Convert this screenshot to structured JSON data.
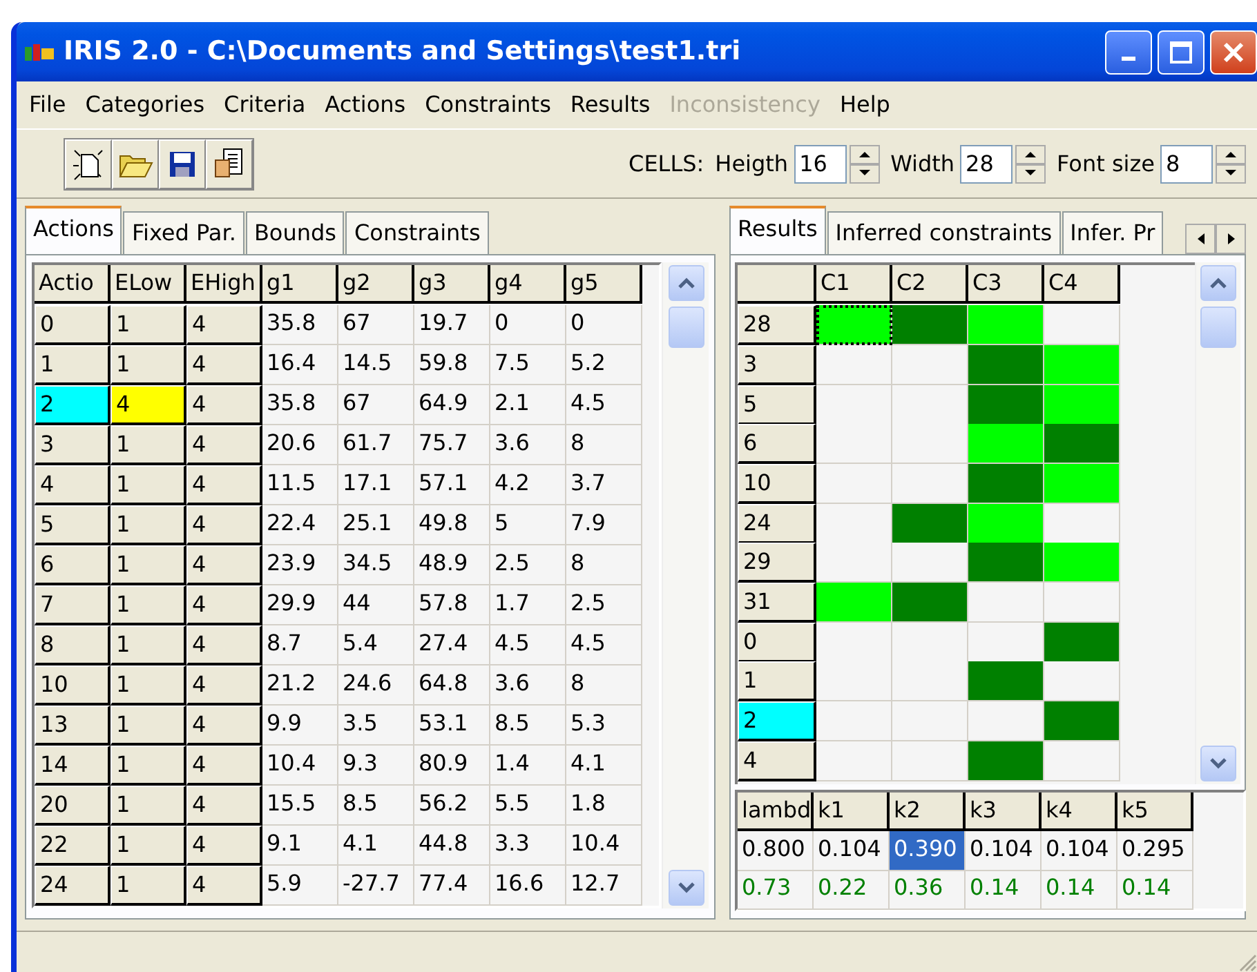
{
  "window": {
    "title": "IRIS 2.0  -  C:\\Documents and Settings\\test1.tri"
  },
  "menu": [
    {
      "label": "File",
      "disabled": false
    },
    {
      "label": "Categories",
      "disabled": false
    },
    {
      "label": "Criteria",
      "disabled": false
    },
    {
      "label": "Actions",
      "disabled": false
    },
    {
      "label": "Constraints",
      "disabled": false
    },
    {
      "label": "Results",
      "disabled": false
    },
    {
      "label": "Inconsistency",
      "disabled": true
    },
    {
      "label": "Help",
      "disabled": false
    }
  ],
  "toolbar": {
    "cells_label": "CELLS:",
    "spinners": [
      {
        "label": "Heigth",
        "value": "16"
      },
      {
        "label": "Width",
        "value": "28"
      },
      {
        "label": "Font size",
        "value": "8"
      }
    ]
  },
  "left_tabs": [
    {
      "label": "Actions",
      "selected": true
    },
    {
      "label": "Fixed Par.",
      "selected": false
    },
    {
      "label": "Bounds",
      "selected": false
    },
    {
      "label": "Constraints",
      "selected": false
    }
  ],
  "actions_table": {
    "columns": [
      "Actio",
      "ELow",
      "EHigh",
      "g1",
      "g2",
      "g3",
      "g4",
      "g5"
    ],
    "rows": [
      {
        "action": "0",
        "selected": false,
        "elow": "1",
        "modified": false,
        "ehigh": "4",
        "values": [
          "35.8",
          "67",
          "19.7",
          "0",
          "0"
        ]
      },
      {
        "action": "1",
        "selected": false,
        "elow": "1",
        "modified": false,
        "ehigh": "4",
        "values": [
          "16.4",
          "14.5",
          "59.8",
          "7.5",
          "5.2"
        ]
      },
      {
        "action": "2",
        "selected": true,
        "elow": "4",
        "modified": true,
        "ehigh": "4",
        "values": [
          "35.8",
          "67",
          "64.9",
          "2.1",
          "4.5"
        ]
      },
      {
        "action": "3",
        "selected": false,
        "elow": "1",
        "modified": false,
        "ehigh": "4",
        "values": [
          "20.6",
          "61.7",
          "75.7",
          "3.6",
          "8"
        ]
      },
      {
        "action": "4",
        "selected": false,
        "elow": "1",
        "modified": false,
        "ehigh": "4",
        "values": [
          "11.5",
          "17.1",
          "57.1",
          "4.2",
          "3.7"
        ]
      },
      {
        "action": "5",
        "selected": false,
        "elow": "1",
        "modified": false,
        "ehigh": "4",
        "values": [
          "22.4",
          "25.1",
          "49.8",
          "5",
          "7.9"
        ]
      },
      {
        "action": "6",
        "selected": false,
        "elow": "1",
        "modified": false,
        "ehigh": "4",
        "values": [
          "23.9",
          "34.5",
          "48.9",
          "2.5",
          "8"
        ]
      },
      {
        "action": "7",
        "selected": false,
        "elow": "1",
        "modified": false,
        "ehigh": "4",
        "values": [
          "29.9",
          "44",
          "57.8",
          "1.7",
          "2.5"
        ]
      },
      {
        "action": "8",
        "selected": false,
        "elow": "1",
        "modified": false,
        "ehigh": "4",
        "values": [
          "8.7",
          "5.4",
          "27.4",
          "4.5",
          "4.5"
        ]
      },
      {
        "action": "10",
        "selected": false,
        "elow": "1",
        "modified": false,
        "ehigh": "4",
        "values": [
          "21.2",
          "24.6",
          "64.8",
          "3.6",
          "8"
        ]
      },
      {
        "action": "13",
        "selected": false,
        "elow": "1",
        "modified": false,
        "ehigh": "4",
        "values": [
          "9.9",
          "3.5",
          "53.1",
          "8.5",
          "5.3"
        ]
      },
      {
        "action": "14",
        "selected": false,
        "elow": "1",
        "modified": false,
        "ehigh": "4",
        "values": [
          "10.4",
          "9.3",
          "80.9",
          "1.4",
          "4.1"
        ]
      },
      {
        "action": "20",
        "selected": false,
        "elow": "1",
        "modified": false,
        "ehigh": "4",
        "values": [
          "15.5",
          "8.5",
          "56.2",
          "5.5",
          "1.8"
        ]
      },
      {
        "action": "22",
        "selected": false,
        "elow": "1",
        "modified": false,
        "ehigh": "4",
        "values": [
          "9.1",
          "4.1",
          "44.8",
          "3.3",
          "10.4"
        ]
      },
      {
        "action": "24",
        "selected": false,
        "elow": "1",
        "modified": false,
        "ehigh": "4",
        "values": [
          "5.9",
          "-27.7",
          "77.4",
          "16.6",
          "12.7"
        ]
      }
    ]
  },
  "right_tabs": [
    {
      "label": "Results",
      "selected": true
    },
    {
      "label": "Inferred constraints",
      "selected": false
    },
    {
      "label": "Infer. Pr",
      "selected": false
    }
  ],
  "results_grid": {
    "columns": [
      "C1",
      "C2",
      "C3",
      "C4"
    ],
    "rows": [
      {
        "label": "28",
        "selected": false,
        "cells": [
          {
            "color": "#00ff00",
            "focused": true
          },
          {
            "color": "#008000",
            "focused": false
          },
          {
            "color": "#00ff00",
            "focused": false
          },
          {
            "color": "#f5f5f5",
            "focused": false
          }
        ]
      },
      {
        "label": "3",
        "selected": false,
        "cells": [
          {
            "color": "#f5f5f5",
            "focused": false
          },
          {
            "color": "#f5f5f5",
            "focused": false
          },
          {
            "color": "#008000",
            "focused": false
          },
          {
            "color": "#00ff00",
            "focused": false
          }
        ]
      },
      {
        "label": "5",
        "selected": false,
        "cells": [
          {
            "color": "#f5f5f5",
            "focused": false
          },
          {
            "color": "#f5f5f5",
            "focused": false
          },
          {
            "color": "#008000",
            "focused": false
          },
          {
            "color": "#00ff00",
            "focused": false
          }
        ]
      },
      {
        "label": "6",
        "selected": false,
        "cells": [
          {
            "color": "#f5f5f5",
            "focused": false
          },
          {
            "color": "#f5f5f5",
            "focused": false
          },
          {
            "color": "#00ff00",
            "focused": false
          },
          {
            "color": "#008000",
            "focused": false
          }
        ]
      },
      {
        "label": "10",
        "selected": false,
        "cells": [
          {
            "color": "#f5f5f5",
            "focused": false
          },
          {
            "color": "#f5f5f5",
            "focused": false
          },
          {
            "color": "#008000",
            "focused": false
          },
          {
            "color": "#00ff00",
            "focused": false
          }
        ]
      },
      {
        "label": "24",
        "selected": false,
        "cells": [
          {
            "color": "#f5f5f5",
            "focused": false
          },
          {
            "color": "#008000",
            "focused": false
          },
          {
            "color": "#00ff00",
            "focused": false
          },
          {
            "color": "#f5f5f5",
            "focused": false
          }
        ]
      },
      {
        "label": "29",
        "selected": false,
        "cells": [
          {
            "color": "#f5f5f5",
            "focused": false
          },
          {
            "color": "#f5f5f5",
            "focused": false
          },
          {
            "color": "#008000",
            "focused": false
          },
          {
            "color": "#00ff00",
            "focused": false
          }
        ]
      },
      {
        "label": "31",
        "selected": false,
        "cells": [
          {
            "color": "#00ff00",
            "focused": false
          },
          {
            "color": "#008000",
            "focused": false
          },
          {
            "color": "#f5f5f5",
            "focused": false
          },
          {
            "color": "#f5f5f5",
            "focused": false
          }
        ]
      },
      {
        "label": "0",
        "selected": false,
        "cells": [
          {
            "color": "#f5f5f5",
            "focused": false
          },
          {
            "color": "#f5f5f5",
            "focused": false
          },
          {
            "color": "#f5f5f5",
            "focused": false
          },
          {
            "color": "#008000",
            "focused": false
          }
        ]
      },
      {
        "label": "1",
        "selected": false,
        "cells": [
          {
            "color": "#f5f5f5",
            "focused": false
          },
          {
            "color": "#f5f5f5",
            "focused": false
          },
          {
            "color": "#008000",
            "focused": false
          },
          {
            "color": "#f5f5f5",
            "focused": false
          }
        ]
      },
      {
        "label": "2",
        "selected": true,
        "cells": [
          {
            "color": "#f5f5f5",
            "focused": false
          },
          {
            "color": "#f5f5f5",
            "focused": false
          },
          {
            "color": "#f5f5f5",
            "focused": false
          },
          {
            "color": "#008000",
            "focused": false
          }
        ]
      },
      {
        "label": "4",
        "selected": false,
        "cells": [
          {
            "color": "#f5f5f5",
            "focused": false
          },
          {
            "color": "#f5f5f5",
            "focused": false
          },
          {
            "color": "#008000",
            "focused": false
          },
          {
            "color": "#f5f5f5",
            "focused": false
          }
        ]
      }
    ]
  },
  "parameters_table": {
    "columns": [
      "lambd",
      "k1",
      "k2",
      "k3",
      "k4",
      "k5"
    ],
    "values": [
      {
        "text": "0.800",
        "selected": false
      },
      {
        "text": "0.104",
        "selected": false
      },
      {
        "text": "0.390",
        "selected": true
      },
      {
        "text": "0.104",
        "selected": false
      },
      {
        "text": "0.104",
        "selected": false
      },
      {
        "text": "0.295",
        "selected": false
      }
    ],
    "inferred": [
      "0.73",
      "0.22",
      "0.36",
      "0.14",
      "0.14",
      "0.14"
    ]
  }
}
